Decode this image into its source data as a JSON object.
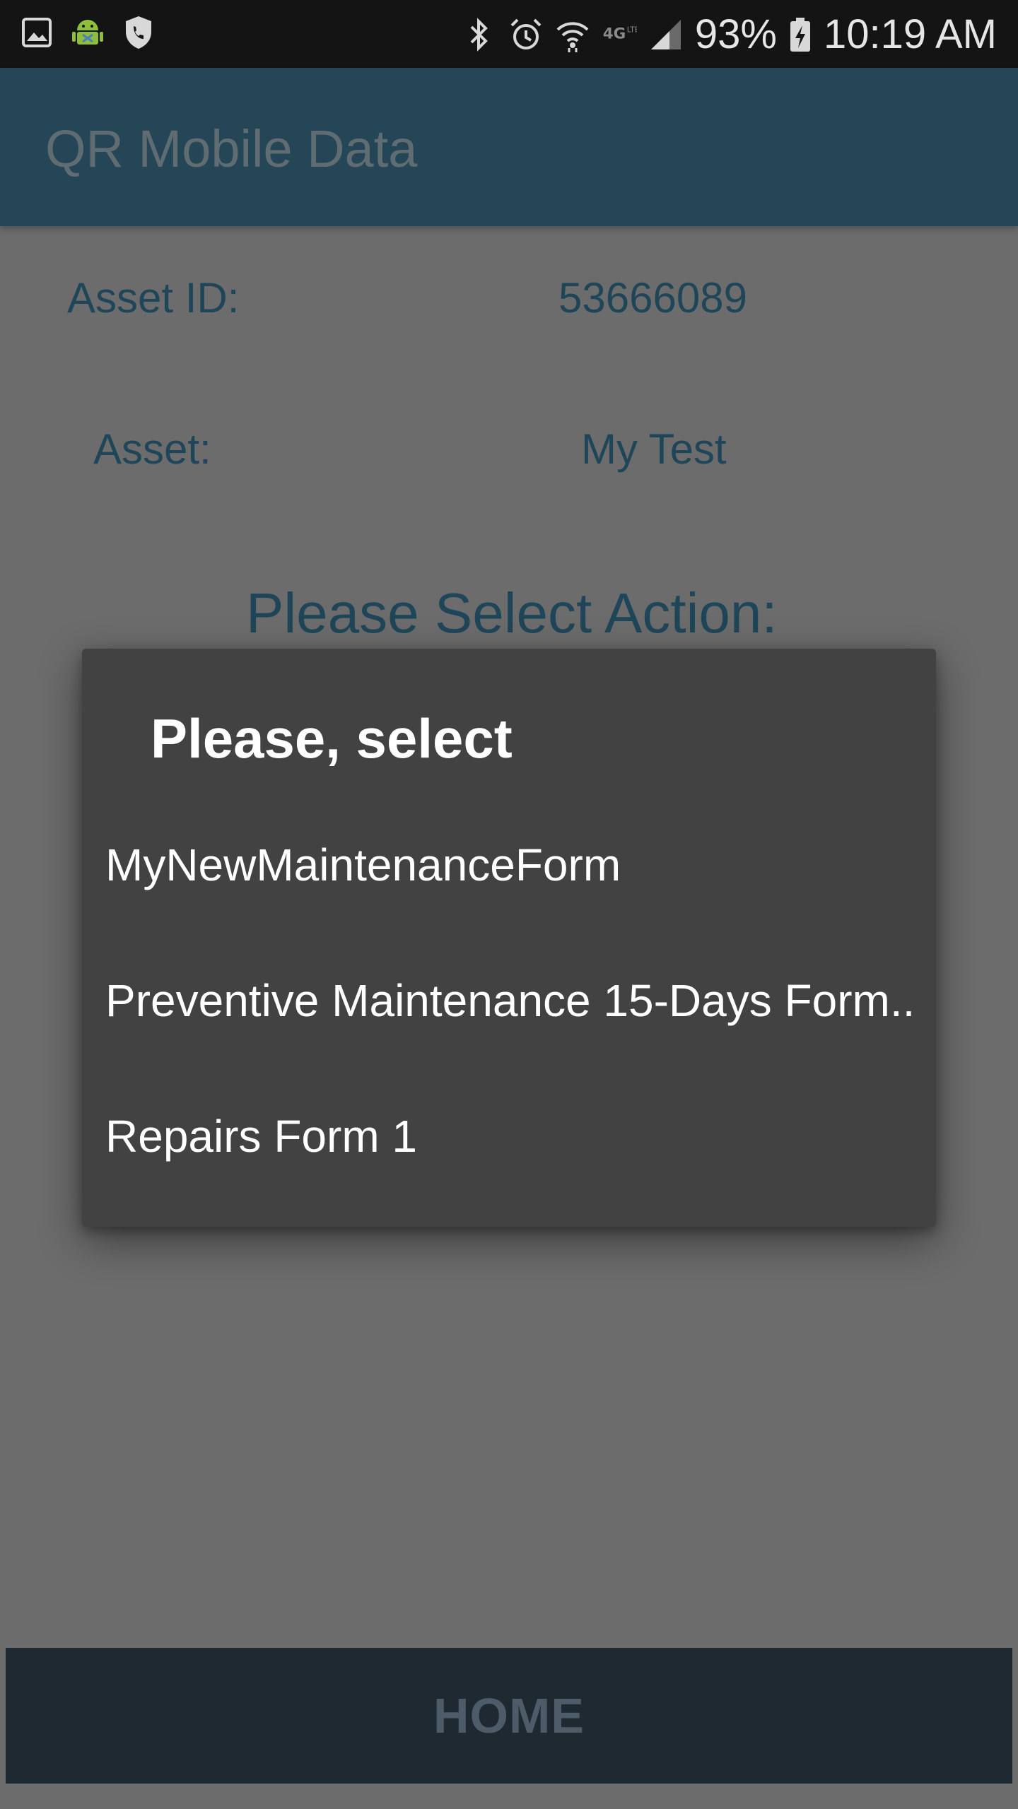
{
  "status_bar": {
    "left_icons": [
      "gallery-icon",
      "android-debug-icon",
      "shield-phone-icon"
    ],
    "right_icons": [
      "bluetooth-icon",
      "alarm-icon",
      "wifi-icon",
      "network-4g-icon",
      "signal-icon"
    ],
    "battery_percent": "93%",
    "time": "10:19 AM"
  },
  "app_bar": {
    "title": "QR Mobile Data"
  },
  "details": {
    "asset_id_label": "Asset ID:",
    "asset_id_value": "53666089",
    "asset_label": "Asset:",
    "asset_value": "My Test"
  },
  "action_heading": "Please Select Action:",
  "dialog": {
    "title": "Please, select",
    "items": [
      {
        "label": "MyNewMaintenanceForm"
      },
      {
        "label": "Preventive Maintenance 15-Days Form.."
      },
      {
        "label": "Repairs Form 1"
      }
    ]
  },
  "bottom": {
    "home_label": "HOME"
  },
  "colors": {
    "app_bar": "#244656",
    "scrim_background": "#6c6c6c",
    "dialog_background": "#424242",
    "text_teal": "#1f4658",
    "home_bar": "#1e2932"
  }
}
